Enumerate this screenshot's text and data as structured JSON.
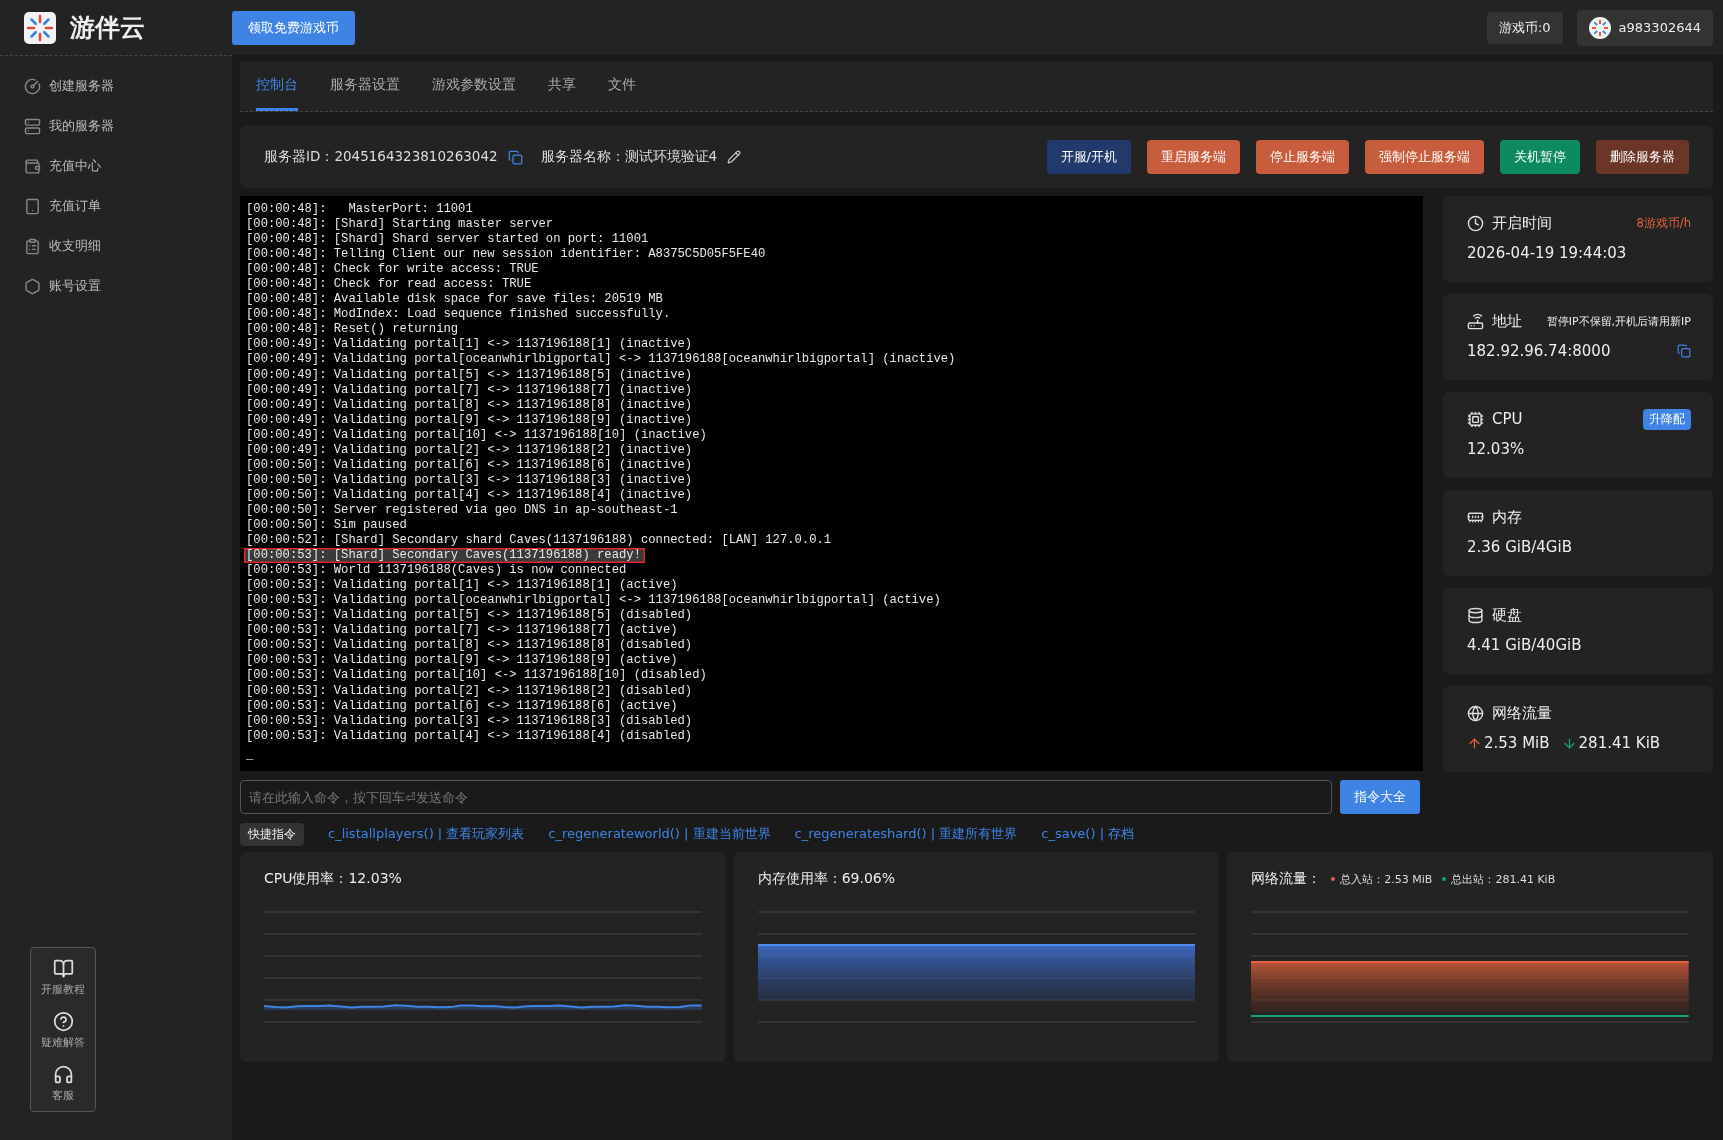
{
  "brand": {
    "name": "游伴云"
  },
  "header": {
    "promo_button": "领取免费游戏币",
    "coins": "游戏币:0",
    "user": "a983302644"
  },
  "sidebar": {
    "items": [
      {
        "kind": "create",
        "label": "创建服务器"
      },
      {
        "kind": "servers",
        "label": "我的服务器"
      },
      {
        "kind": "recharge",
        "label": "充值中心"
      },
      {
        "kind": "orders",
        "label": "充值订单"
      },
      {
        "kind": "ledger",
        "label": "收支明细"
      },
      {
        "kind": "account",
        "label": "账号设置"
      }
    ],
    "help": [
      {
        "kind": "guide",
        "label": "开服教程"
      },
      {
        "kind": "faq",
        "label": "疑难解答"
      },
      {
        "kind": "support",
        "label": "客服"
      }
    ]
  },
  "tabs": [
    {
      "label": "控制台",
      "selected": true
    },
    {
      "label": "服务器设置",
      "selected": false
    },
    {
      "label": "游戏参数设置",
      "selected": false
    },
    {
      "label": "共享",
      "selected": false
    },
    {
      "label": "文件",
      "selected": false
    }
  ],
  "server": {
    "id_label": "服务器ID：",
    "id": "2045164323810263042",
    "name_label": "服务器名称：",
    "name": "测试环境验证4"
  },
  "actions": [
    {
      "label": "开服/开机",
      "color": "#223a6b"
    },
    {
      "label": "重启服务端",
      "color": "#c85d3e"
    },
    {
      "label": "停止服务端",
      "color": "#c85d3e"
    },
    {
      "label": "强制停止服务端",
      "color": "#c85d3e"
    },
    {
      "label": "关机暂停",
      "color": "#0e8a5f"
    },
    {
      "label": "删除服务器",
      "color": "#6b3527"
    }
  ],
  "console": {
    "cursor": "_",
    "lines": [
      {
        "text": "[00:00:48]:   MasterPort: 11001",
        "highlighted": false
      },
      {
        "text": "[00:00:48]: [Shard] Starting master server",
        "highlighted": false
      },
      {
        "text": "[00:00:48]: [Shard] Shard server started on port: 11001",
        "highlighted": false
      },
      {
        "text": "[00:00:48]: Telling Client our new session identifier: A8375C5D05F5FE40",
        "highlighted": false
      },
      {
        "text": "[00:00:48]: Check for write access: TRUE",
        "highlighted": false
      },
      {
        "text": "[00:00:48]: Check for read access: TRUE",
        "highlighted": false
      },
      {
        "text": "[00:00:48]: Available disk space for save files: 20519 MB",
        "highlighted": false
      },
      {
        "text": "[00:00:48]: ModIndex: Load sequence finished successfully.",
        "highlighted": false
      },
      {
        "text": "[00:00:48]: Reset() returning",
        "highlighted": false
      },
      {
        "text": "[00:00:49]: Validating portal[1] <-> 1137196188[1] (inactive)",
        "highlighted": false
      },
      {
        "text": "[00:00:49]: Validating portal[oceanwhirlbigportal] <-> 1137196188[oceanwhirlbigportal] (inactive)",
        "highlighted": false
      },
      {
        "text": "[00:00:49]: Validating portal[5] <-> 1137196188[5] (inactive)",
        "highlighted": false
      },
      {
        "text": "[00:00:49]: Validating portal[7] <-> 1137196188[7] (inactive)",
        "highlighted": false
      },
      {
        "text": "[00:00:49]: Validating portal[8] <-> 1137196188[8] (inactive)",
        "highlighted": false
      },
      {
        "text": "[00:00:49]: Validating portal[9] <-> 1137196188[9] (inactive)",
        "highlighted": false
      },
      {
        "text": "[00:00:49]: Validating portal[10] <-> 1137196188[10] (inactive)",
        "highlighted": false
      },
      {
        "text": "[00:00:49]: Validating portal[2] <-> 1137196188[2] (inactive)",
        "highlighted": false
      },
      {
        "text": "[00:00:50]: Validating portal[6] <-> 1137196188[6] (inactive)",
        "highlighted": false
      },
      {
        "text": "[00:00:50]: Validating portal[3] <-> 1137196188[3] (inactive)",
        "highlighted": false
      },
      {
        "text": "[00:00:50]: Validating portal[4] <-> 1137196188[4] (inactive)",
        "highlighted": false
      },
      {
        "text": "[00:00:50]: Server registered via geo DNS in ap-southeast-1",
        "highlighted": false
      },
      {
        "text": "[00:00:50]: Sim paused",
        "highlighted": false
      },
      {
        "text": "[00:00:52]: [Shard] Secondary shard Caves(1137196188) connected: [LAN] 127.0.0.1",
        "highlighted": false
      },
      {
        "text": "[00:00:53]: [Shard] Secondary Caves(1137196188) ready!",
        "highlighted": true
      },
      {
        "text": "[00:00:53]: World 1137196188(Caves) is now connected",
        "highlighted": false
      },
      {
        "text": "[00:00:53]: Validating portal[1] <-> 1137196188[1] (active)",
        "highlighted": false
      },
      {
        "text": "[00:00:53]: Validating portal[oceanwhirlbigportal] <-> 1137196188[oceanwhirlbigportal] (active)",
        "highlighted": false
      },
      {
        "text": "[00:00:53]: Validating portal[5] <-> 1137196188[5] (disabled)",
        "highlighted": false
      },
      {
        "text": "[00:00:53]: Validating portal[7] <-> 1137196188[7] (active)",
        "highlighted": false
      },
      {
        "text": "[00:00:53]: Validating portal[8] <-> 1137196188[8] (disabled)",
        "highlighted": false
      },
      {
        "text": "[00:00:53]: Validating portal[9] <-> 1137196188[9] (active)",
        "highlighted": false
      },
      {
        "text": "[00:00:53]: Validating portal[10] <-> 1137196188[10] (disabled)",
        "highlighted": false
      },
      {
        "text": "[00:00:53]: Validating portal[2] <-> 1137196188[2] (disabled)",
        "highlighted": false
      },
      {
        "text": "[00:00:53]: Validating portal[6] <-> 1137196188[6] (active)",
        "highlighted": false
      },
      {
        "text": "[00:00:53]: Validating portal[3] <-> 1137196188[3] (disabled)",
        "highlighted": false
      },
      {
        "text": "[00:00:53]: Validating portal[4] <-> 1137196188[4] (disabled)",
        "highlighted": false
      }
    ]
  },
  "stats": [
    {
      "kind": "time",
      "title": "开启时间",
      "note": "8游戏币/h",
      "value": "2026-04-19 19:44:03"
    },
    {
      "kind": "address",
      "title": "地址",
      "note": "暂停IP不保留,开机后请用新IP",
      "value": "182.92.96.74:8000"
    },
    {
      "kind": "cpu",
      "title": "CPU",
      "button": "升降配",
      "value": "12.03%"
    },
    {
      "kind": "memory",
      "title": "内存",
      "value": "2.36 GiB/4GiB"
    },
    {
      "kind": "disk",
      "title": "硬盘",
      "value": "4.41 GiB/40GiB"
    },
    {
      "kind": "network",
      "title": "网络流量",
      "up": "2.53 MiB",
      "down": "281.41 KiB"
    }
  ],
  "command": {
    "placeholder": "请在此输入命令，按下回车⏎发送命令",
    "button": "指令大全"
  },
  "quick": {
    "label": "快捷指令",
    "commands": [
      "c_listallplayers() | 查看玩家列表",
      "c_regenerateworld() | 重建当前世界",
      "c_regenerateshard() | 重建所有世界",
      "c_save() | 存档"
    ]
  },
  "charts": [
    {
      "kind": "cpu",
      "title": "CPU使用率：12.03%"
    },
    {
      "kind": "memory",
      "title": "内存使用率：69.06%"
    },
    {
      "kind": "network",
      "title": "网络流量：",
      "legend": [
        {
          "label": "总入站：2.53 MiB",
          "color": "#e0623e"
        },
        {
          "label": "总出站：281.41 KiB",
          "color": "#15a46f"
        }
      ]
    }
  ]
}
